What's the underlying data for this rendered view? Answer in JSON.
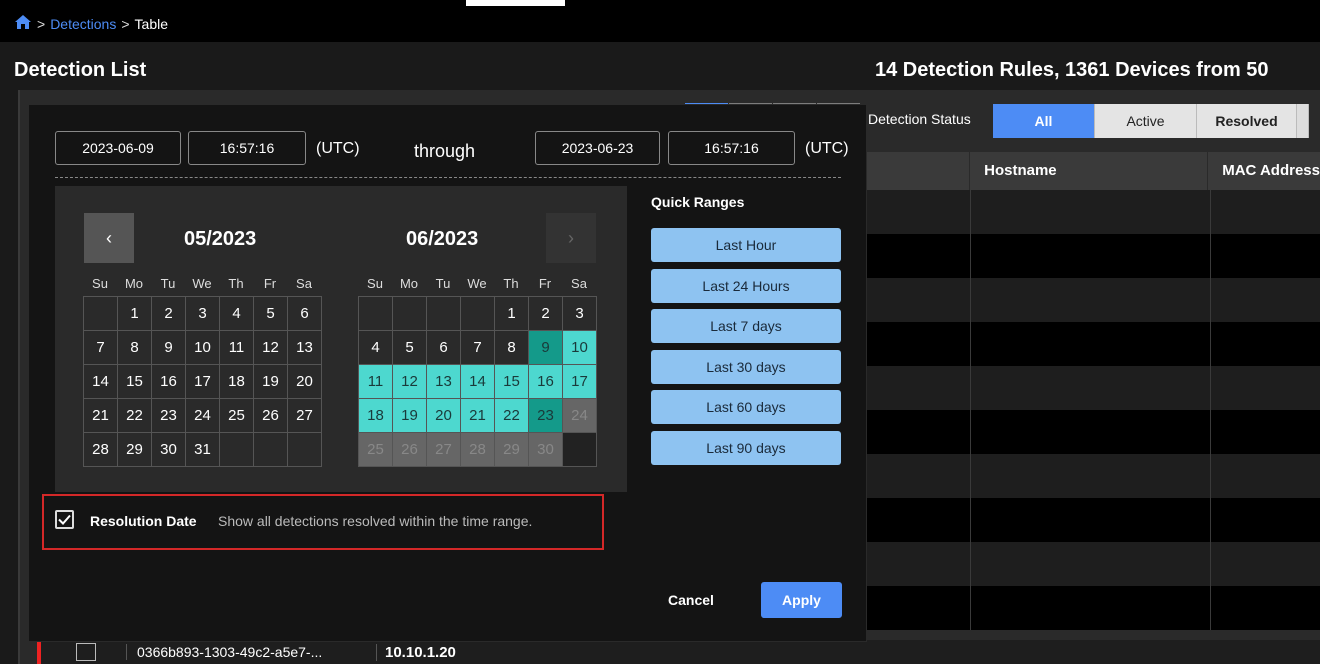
{
  "breadcrumb": {
    "home_icon": "home-icon",
    "sep1": ">",
    "detections": "Detections",
    "sep2": ">",
    "current": "Table"
  },
  "page": {
    "title": "Detection List",
    "summary": "14 Detection Rules, 1361 Devices from 50"
  },
  "status_filter": {
    "label": "Detection Status",
    "options": [
      "All",
      "Active",
      "Resolved"
    ],
    "selected": "All"
  },
  "table": {
    "columns": [
      "Hostname",
      "MAC Address"
    ],
    "visible_row": {
      "uuid": "0366b893-1303-49c2-a5e7-...",
      "ip": "10.10.1.20"
    }
  },
  "date_picker": {
    "start_date": "2023-06-09",
    "start_time": "16:57:16",
    "start_tz": "(UTC)",
    "through": "through",
    "end_date": "2023-06-23",
    "end_time": "16:57:16",
    "end_tz": "(UTC)",
    "prev_label": "‹",
    "next_label": "›",
    "weekdays": [
      "Su",
      "Mo",
      "Tu",
      "We",
      "Th",
      "Fr",
      "Sa"
    ],
    "months": [
      {
        "title": "05/2023",
        "cells": [
          "",
          "1",
          "2",
          "3",
          "4",
          "5",
          "6",
          "7",
          "8",
          "9",
          "10",
          "11",
          "12",
          "13",
          "14",
          "15",
          "16",
          "17",
          "18",
          "19",
          "20",
          "21",
          "22",
          "23",
          "24",
          "25",
          "26",
          "27",
          "28",
          "29",
          "30",
          "31",
          "",
          "",
          ""
        ]
      },
      {
        "title": "06/2023",
        "cells": [
          "",
          "",
          "",
          "",
          "1",
          "2",
          "3",
          "4",
          "5",
          "6",
          "7",
          "8",
          "9",
          "10",
          "11",
          "12",
          "13",
          "14",
          "15",
          "16",
          "17",
          "18",
          "19",
          "20",
          "21",
          "22",
          "23",
          "24",
          "25",
          "26",
          "27",
          "28",
          "29",
          "30",
          ""
        ],
        "range_start": "9",
        "range_end": "23",
        "disabled_after": "23"
      }
    ],
    "quick_ranges_title": "Quick Ranges",
    "quick_ranges": [
      "Last Hour",
      "Last 24 Hours",
      "Last 7 days",
      "Last 30 days",
      "Last 60 days",
      "Last 90 days"
    ],
    "resolution": {
      "checked": true,
      "label": "Resolution Date",
      "description": "Show all detections resolved within the time range."
    },
    "cancel_label": "Cancel",
    "apply_label": "Apply"
  },
  "colors": {
    "accent": "#4d8cf5",
    "range": "#4dd8cf",
    "range_edge": "#149a8a",
    "quick_range": "#8ec3f1",
    "highlight_box": "#d42828"
  }
}
